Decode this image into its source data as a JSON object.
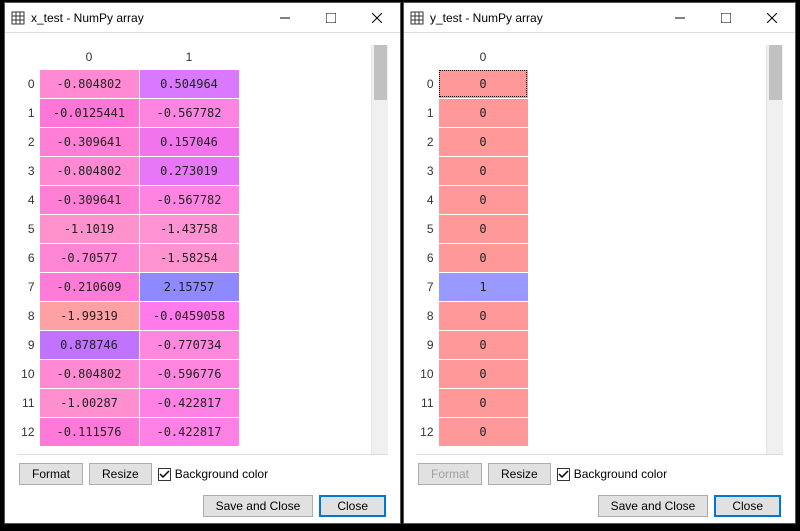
{
  "left": {
    "title": "x_test - NumPy array",
    "columns": [
      "0",
      "1"
    ],
    "rows": [
      {
        "idx": "0",
        "cells": [
          {
            "v": "-0.804802",
            "bg": "#ff89d3"
          },
          {
            "v": "0.504964",
            "bg": "#d979ff"
          }
        ]
      },
      {
        "idx": "1",
        "cells": [
          {
            "v": "-0.0125441",
            "bg": "#ff76d8"
          },
          {
            "v": "-0.567782",
            "bg": "#ff84e1"
          }
        ]
      },
      {
        "idx": "2",
        "cells": [
          {
            "v": "-0.309641",
            "bg": "#ff7ed6"
          },
          {
            "v": "0.157046",
            "bg": "#f274ed"
          }
        ]
      },
      {
        "idx": "3",
        "cells": [
          {
            "v": "-0.804802",
            "bg": "#ff89d3"
          },
          {
            "v": "0.273019",
            "bg": "#e777f6"
          }
        ]
      },
      {
        "idx": "4",
        "cells": [
          {
            "v": "-0.309641",
            "bg": "#ff7ed6"
          },
          {
            "v": "-0.567782",
            "bg": "#ff84e1"
          }
        ]
      },
      {
        "idx": "5",
        "cells": [
          {
            "v": "-1.1019",
            "bg": "#ff91cc"
          },
          {
            "v": "-1.43758",
            "bg": "#ff92d2"
          }
        ]
      },
      {
        "idx": "6",
        "cells": [
          {
            "v": "-0.70577",
            "bg": "#ff86d4"
          },
          {
            "v": "-1.58254",
            "bg": "#ff93d0"
          }
        ]
      },
      {
        "idx": "7",
        "cells": [
          {
            "v": "-0.210609",
            "bg": "#ff7bd8"
          },
          {
            "v": "2.15757",
            "bg": "#8f89ff"
          }
        ]
      },
      {
        "idx": "8",
        "cells": [
          {
            "v": "-1.99319",
            "bg": "#ffa0a5"
          },
          {
            "v": "-0.0459058",
            "bg": "#ff7aeb"
          }
        ]
      },
      {
        "idx": "9",
        "cells": [
          {
            "v": "0.878746",
            "bg": "#c073ff"
          },
          {
            "v": "-0.770734",
            "bg": "#ff87dd"
          }
        ]
      },
      {
        "idx": "10",
        "cells": [
          {
            "v": "-0.804802",
            "bg": "#ff89d3"
          },
          {
            "v": "-0.596776",
            "bg": "#ff85e0"
          }
        ]
      },
      {
        "idx": "11",
        "cells": [
          {
            "v": "-1.00287",
            "bg": "#ff8fcf"
          },
          {
            "v": "-0.422817",
            "bg": "#ff81e5"
          }
        ]
      },
      {
        "idx": "12",
        "cells": [
          {
            "v": "-0.111576",
            "bg": "#ff79d8"
          },
          {
            "v": "-0.422817",
            "bg": "#ff81e5"
          }
        ]
      }
    ],
    "buttons": {
      "format": "Format",
      "resize": "Resize",
      "bgcolor": "Background color",
      "save_close": "Save and Close",
      "close": "Close"
    },
    "format_enabled": true
  },
  "right": {
    "title": "y_test - NumPy array",
    "columns": [
      "0"
    ],
    "rows": [
      {
        "idx": "0",
        "cells": [
          {
            "v": "0",
            "bg": "#ff9999"
          }
        ],
        "selected": true
      },
      {
        "idx": "1",
        "cells": [
          {
            "v": "0",
            "bg": "#ff9999"
          }
        ]
      },
      {
        "idx": "2",
        "cells": [
          {
            "v": "0",
            "bg": "#ff9999"
          }
        ]
      },
      {
        "idx": "3",
        "cells": [
          {
            "v": "0",
            "bg": "#ff9999"
          }
        ]
      },
      {
        "idx": "4",
        "cells": [
          {
            "v": "0",
            "bg": "#ff9999"
          }
        ]
      },
      {
        "idx": "5",
        "cells": [
          {
            "v": "0",
            "bg": "#ff9999"
          }
        ]
      },
      {
        "idx": "6",
        "cells": [
          {
            "v": "0",
            "bg": "#ff9999"
          }
        ]
      },
      {
        "idx": "7",
        "cells": [
          {
            "v": "1",
            "bg": "#9999ff"
          }
        ]
      },
      {
        "idx": "8",
        "cells": [
          {
            "v": "0",
            "bg": "#ff9999"
          }
        ]
      },
      {
        "idx": "9",
        "cells": [
          {
            "v": "0",
            "bg": "#ff9999"
          }
        ]
      },
      {
        "idx": "10",
        "cells": [
          {
            "v": "0",
            "bg": "#ff9999"
          }
        ]
      },
      {
        "idx": "11",
        "cells": [
          {
            "v": "0",
            "bg": "#ff9999"
          }
        ]
      },
      {
        "idx": "12",
        "cells": [
          {
            "v": "0",
            "bg": "#ff9999"
          }
        ]
      }
    ],
    "buttons": {
      "format": "Format",
      "resize": "Resize",
      "bgcolor": "Background color",
      "save_close": "Save and Close",
      "close": "Close"
    },
    "format_enabled": false
  }
}
